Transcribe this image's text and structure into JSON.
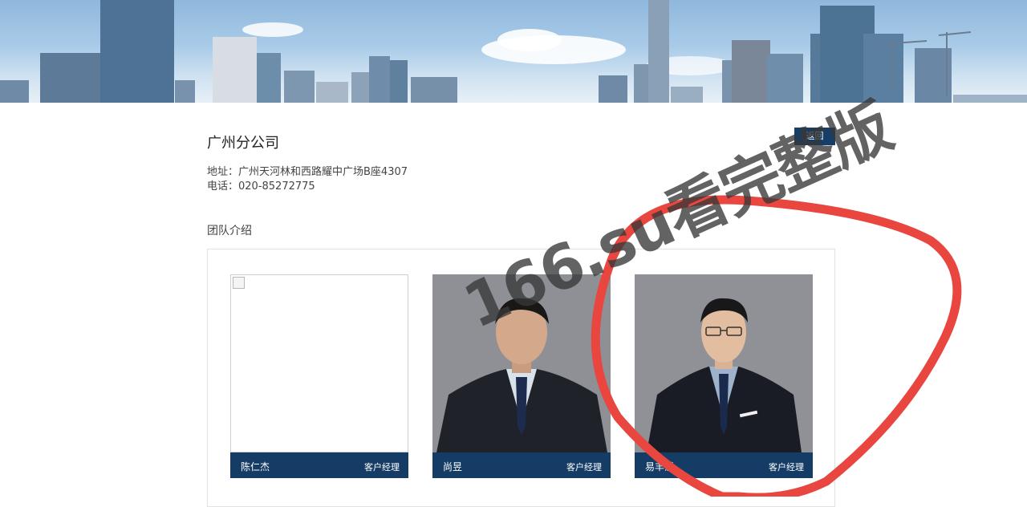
{
  "banner": {
    "alt": "city skyline banner"
  },
  "company": {
    "title": "广州分公司",
    "back_label": "返回",
    "address": "地址：广州天河林和西路耀中广场B座4307",
    "phone": "电话：020-85272775"
  },
  "team": {
    "heading": "团队介绍",
    "members": [
      {
        "name": "陈仁杰",
        "role": "客户经理",
        "photo": "broken-image"
      },
      {
        "name": "尚昱",
        "role": "客户经理",
        "photo": "portrait"
      },
      {
        "name": "易丰慧",
        "role": "客户经理",
        "photo": "portrait"
      }
    ]
  },
  "watermark": {
    "text": "166.su看完整版",
    "circle_color": "#e8463f"
  },
  "colors": {
    "accent": "#173e66",
    "card_bar": "#143c65"
  }
}
